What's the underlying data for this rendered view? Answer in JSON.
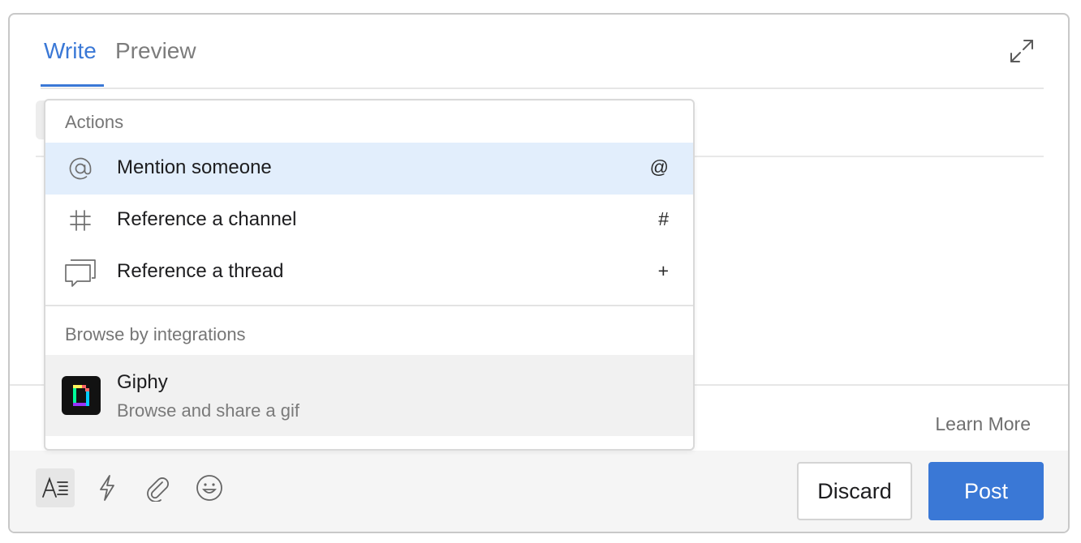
{
  "tabs": [
    {
      "label": "Write",
      "active": true
    },
    {
      "label": "Preview",
      "active": false
    }
  ],
  "popover": {
    "actions_title": "Actions",
    "actions": [
      {
        "icon": "at-icon",
        "label": "Mention someone",
        "shortcut": "@",
        "highlighted": true
      },
      {
        "icon": "hash-icon",
        "label": "Reference a channel",
        "shortcut": "#",
        "highlighted": false
      },
      {
        "icon": "thread-icon",
        "label": "Reference a thread",
        "shortcut": "+",
        "highlighted": false
      }
    ],
    "integrations_title": "Browse by integrations",
    "integrations": [
      {
        "icon": "giphy-logo",
        "name": "Giphy",
        "description": "Browse and share a gif"
      }
    ]
  },
  "footer": {
    "learn_more": "Learn More"
  },
  "bottom_bar": {
    "icons": [
      "text-format-icon",
      "lightning-icon",
      "paperclip-icon",
      "emoji-icon"
    ],
    "discard_label": "Discard",
    "post_label": "Post"
  },
  "colors": {
    "accent": "#3a78d6",
    "highlight": "#e2eefc"
  }
}
